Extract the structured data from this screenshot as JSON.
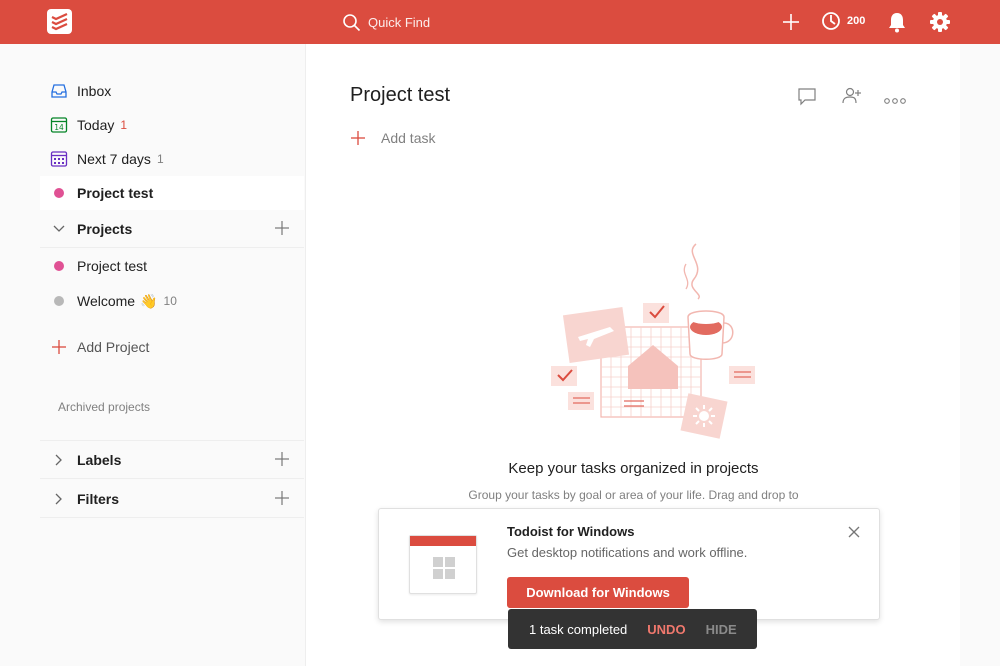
{
  "topbar": {
    "search_placeholder": "Quick Find",
    "karma_value": "200"
  },
  "sidebar": {
    "items": [
      {
        "label": "Inbox",
        "count": ""
      },
      {
        "label": "Today",
        "count": "1"
      },
      {
        "label": "Next 7 days",
        "count": "1"
      },
      {
        "label": "Project test",
        "count": ""
      }
    ],
    "projects_header": "Projects",
    "projects": [
      {
        "label": "Project test",
        "count": "",
        "color": "#e05194"
      },
      {
        "label": "Welcome",
        "emoji": "👋",
        "count": "10",
        "color": "#b8b8b8"
      }
    ],
    "add_project": "Add Project",
    "archived": "Archived projects",
    "labels_header": "Labels",
    "filters_header": "Filters",
    "today_icon_text": "14"
  },
  "main": {
    "title": "Project test",
    "add_task": "Add task",
    "empty_title": "Keep your tasks organized in projects",
    "empty_sub": "Group your tasks by goal or area of your life. Drag and drop to"
  },
  "promo": {
    "title": "Todoist for Windows",
    "desc": "Get desktop notifications and work offline.",
    "button": "Download for Windows"
  },
  "toast": {
    "message": "1 task completed",
    "undo": "UNDO",
    "hide": "HIDE"
  },
  "colors": {
    "brand": "#db4c3f",
    "project_pink": "#e05194",
    "welcome_grey": "#b8b8b8"
  }
}
